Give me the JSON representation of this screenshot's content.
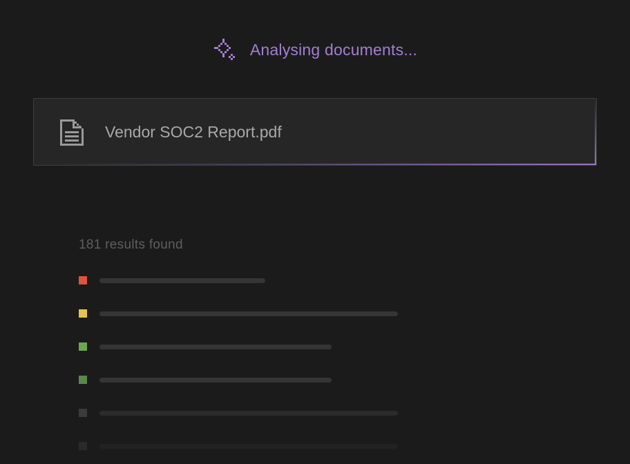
{
  "status": {
    "text": "Analysing documents...",
    "icon": "sparkle-icon",
    "color": "#a27fd0"
  },
  "file": {
    "name": "Vendor SOC2 Report.pdf",
    "icon": "document-icon"
  },
  "results": {
    "count_text": "181 results found",
    "items": [
      {
        "severity_color": "#e0533d"
      },
      {
        "severity_color": "#e8c34a"
      },
      {
        "severity_color": "#6aa84f"
      },
      {
        "severity_color": "#5a8a48"
      },
      {
        "severity_color": "#3c3c3e"
      },
      {
        "severity_color": "#2a2a2b"
      }
    ]
  }
}
